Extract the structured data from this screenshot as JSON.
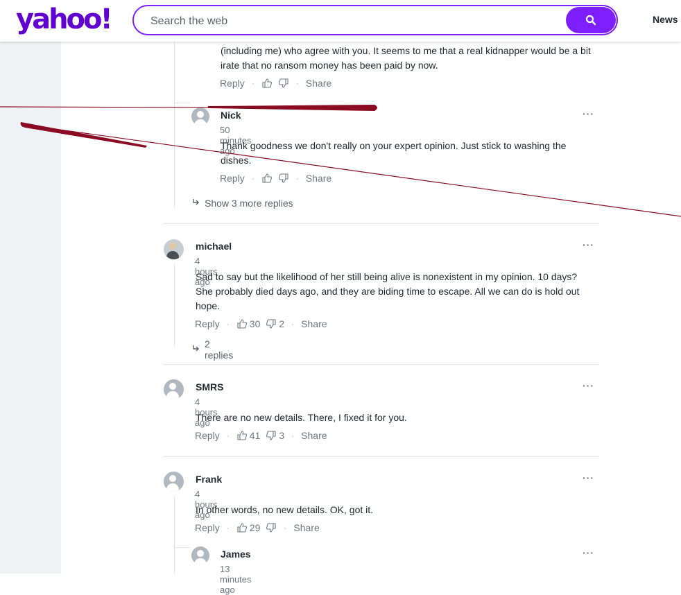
{
  "header": {
    "logo": "yahoo!",
    "search_placeholder": "Search the web",
    "nav_news": "News"
  },
  "colors": {
    "brand": "#6001d2",
    "search_button": "#7e1fff",
    "annotation": "#8a0b22"
  },
  "comments": [
    {
      "text_partial": "(including me) who agree with you.  It seems to me that a real kidnapper would be a bit irate that no ransom money has been paid by now.",
      "reply": "Reply",
      "share": "Share"
    },
    {
      "author": "Nick",
      "time": "50 minutes ago",
      "text": "Thank goodness we don't really on your expert opinion. Just stick to washing the dishes.",
      "reply": "Reply",
      "share": "Share"
    },
    {
      "show_more": "Show 3 more replies"
    },
    {
      "author": "michael",
      "time": "4 hours ago",
      "text": "Sad to say but the likelihood of her still being alive is nonexistent in my opinion. 10 days? She probably died days ago, and they are biding time to escape. All we can do is hold out hope.",
      "reply": "Reply",
      "likes": "30",
      "dislikes": "2",
      "share": "Share",
      "replies": "2 replies"
    },
    {
      "author": "SMRS",
      "time": "4 hours ago",
      "text": "There are no new details.  There, I fixed it for you.",
      "reply": "Reply",
      "likes": "41",
      "dislikes": "3",
      "share": "Share"
    },
    {
      "author": "Frank",
      "time": "4 hours ago",
      "text": "In other words, no new details. OK, got it.",
      "reply": "Reply",
      "likes": "29",
      "share": "Share"
    },
    {
      "author": "James",
      "time": "13 minutes ago"
    }
  ],
  "more_icon": "···"
}
